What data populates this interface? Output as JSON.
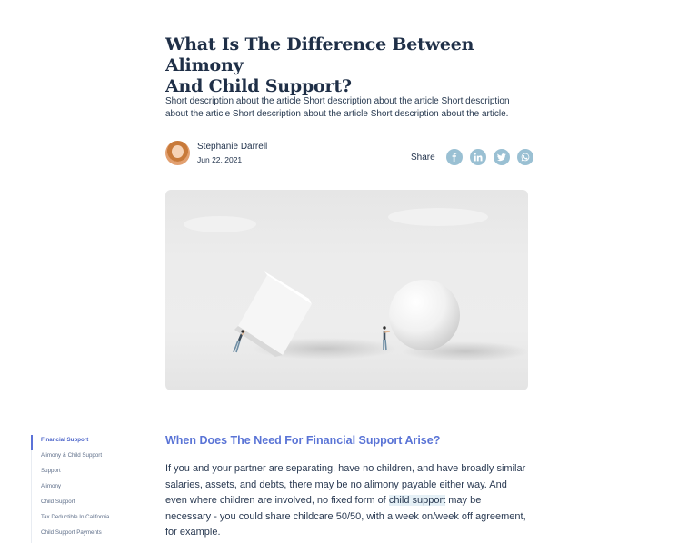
{
  "article": {
    "title_line1": "What Is The Difference Between Alimony",
    "title_line2": "And Child Support?",
    "description": "Short description about the article Short description about the article Short description about the article Short description about the article Short description about the article.",
    "author_name": "Stephanie Darrell",
    "date": "Jun 22, 2021"
  },
  "share": {
    "label": "Share",
    "icons": [
      "facebook-icon",
      "linkedin-icon",
      "twitter-icon",
      "whatsapp-icon"
    ],
    "icon_color": "#9ac0d3"
  },
  "toc": {
    "items": [
      {
        "label": "Financial Support",
        "active": true
      },
      {
        "label": "Alimony & Child Support",
        "active": false
      },
      {
        "label": "Support",
        "active": false
      },
      {
        "label": "Alimony",
        "active": false
      },
      {
        "label": "Child Support",
        "active": false
      },
      {
        "label": "Tax Deductible In California",
        "active": false
      },
      {
        "label": "Child Support Payments",
        "active": false
      }
    ]
  },
  "section": {
    "heading": "When Does The Need For Financial Support Arise?",
    "body_before": "If you and your partner are separating, have no children, and have broadly similar salaries, assets, and debts, there may be no alimony payable either way. And even where children are involved, no fixed form of ",
    "body_link": "child support",
    "body_after": " may be necessary - you could share childcare 50/50, with a week on/week off agreement, for example."
  },
  "colors": {
    "accent": "#5a74d6",
    "text": "#23344d",
    "link_highlight": "#e5f0f6"
  }
}
